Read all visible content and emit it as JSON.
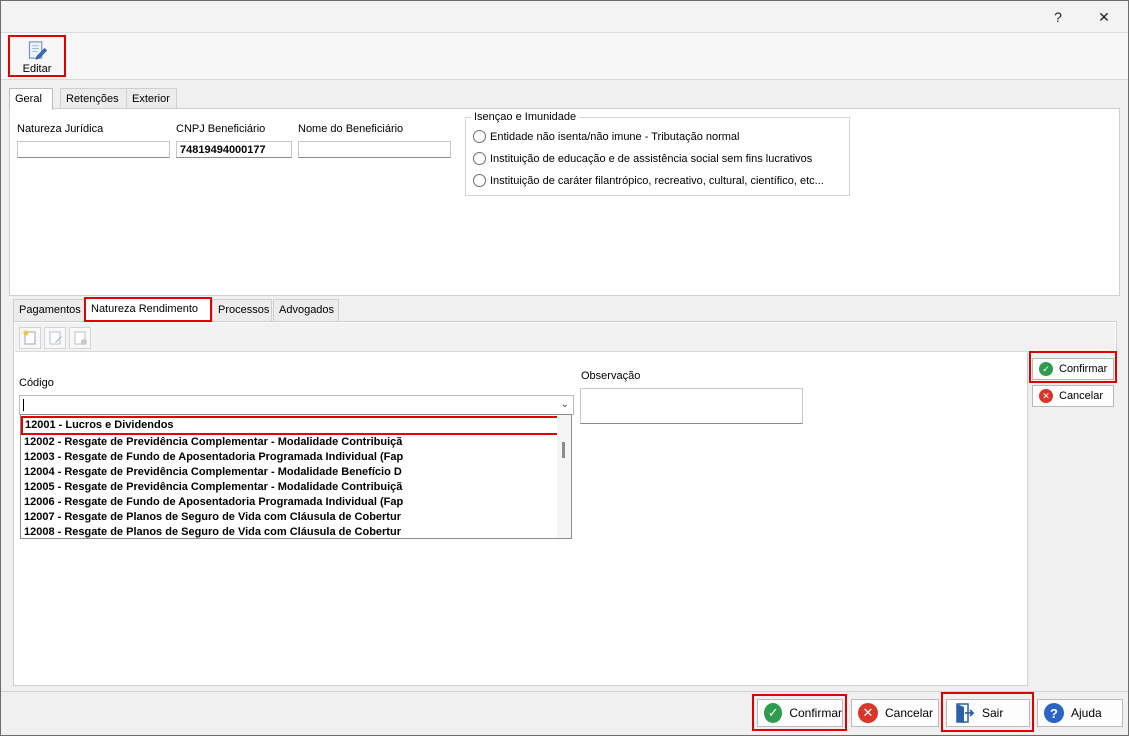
{
  "titlebar": {
    "help_label": "?",
    "close_label": "✕"
  },
  "toolbar": {
    "edit_label": "Editar",
    "edit_icon": "edit-document-icon"
  },
  "top_tabs": [
    {
      "label": "Geral",
      "active": true
    },
    {
      "label": "Retenções",
      "active": false
    },
    {
      "label": "Exterior",
      "active": false
    }
  ],
  "fields": {
    "natureza_juridica": {
      "label": "Natureza Jurídica",
      "value": ""
    },
    "cnpj": {
      "label": "CNPJ Beneficiário",
      "value": "74819494000177"
    },
    "nome": {
      "label": "Nome do Beneficiário",
      "value": ""
    }
  },
  "isencao": {
    "title": "Isençao e Imunidade",
    "options": [
      "Entidade não isenta/não imune - Tributação normal",
      "Instituição de educação e de assistência social sem fins lucrativos",
      "Instituição de caráter filantrópico, recreativo, cultural, científico, etc..."
    ]
  },
  "lower_tabs": [
    {
      "label": "Pagamentos",
      "active": false
    },
    {
      "label": "Natureza Rendimento",
      "active": true
    },
    {
      "label": "Processos",
      "active": false
    },
    {
      "label": "Advogados",
      "active": false
    }
  ],
  "codigo": {
    "label": "Código",
    "value": "",
    "options": [
      "12001 - Lucros e Dividendos",
      "12002 - Resgate de Previdência Complementar - Modalidade Contribuiçã",
      "12003 - Resgate de Fundo de Aposentadoria Programada Individual (Fap",
      "12004 - Resgate de Previdência Complementar - Modalidade Benefício D",
      "12005 - Resgate de Previdência Complementar - Modalidade Contribuiçã",
      "12006 - Resgate de Fundo de Aposentadoria Programada Individual (Fap",
      "12007 - Resgate de Planos de Seguro de Vida com Cláusula de Cobertur",
      "12008 - Resgate de Planos de Seguro de Vida com Cláusula de Cobertur"
    ],
    "selected_index": 0
  },
  "observacao": {
    "label": "Observação",
    "value": ""
  },
  "side_buttons": {
    "confirm_label": "Confirmar",
    "cancel_label": "Cancelar"
  },
  "bottom_buttons": {
    "confirm_label": "Confirmar",
    "cancel_label": "Cancelar",
    "exit_label": "Sair",
    "help_label": "Ajuda"
  },
  "colors": {
    "highlight": "#e00000",
    "confirm_green": "#2e9b4f",
    "cancel_red": "#d9362b",
    "help_blue": "#2b64c5"
  }
}
